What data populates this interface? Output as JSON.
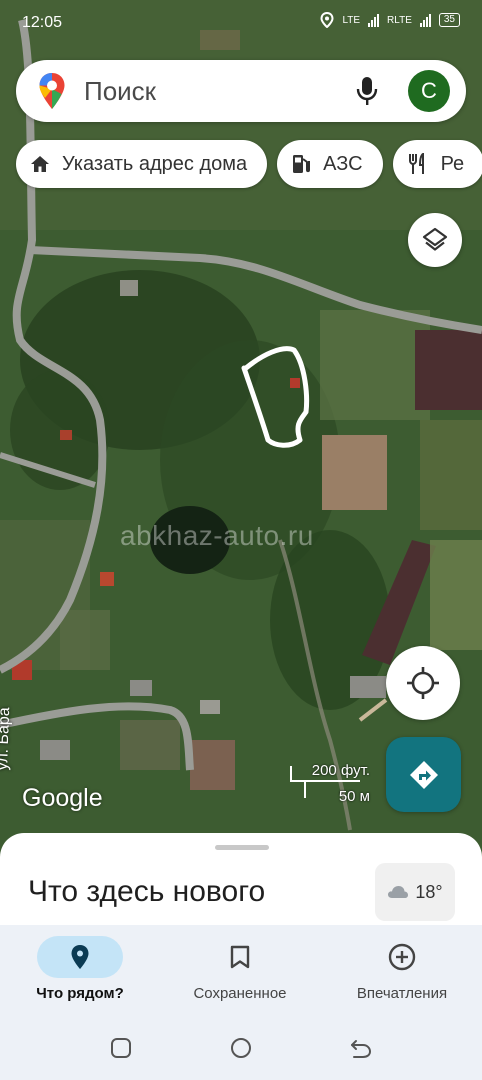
{
  "status_bar": {
    "time": "12:05",
    "lte1": "LTE",
    "lte2": "RLTE",
    "battery": "35"
  },
  "search": {
    "placeholder": "Поиск",
    "avatar_letter": "С"
  },
  "chips": [
    {
      "icon": "home-icon",
      "label": "Указать адрес дома"
    },
    {
      "icon": "gas-station-icon",
      "label": "АЗС"
    },
    {
      "icon": "restaurant-icon",
      "label": "Ре"
    }
  ],
  "map": {
    "watermark": "abkhaz-auto.ru",
    "logo": "Google",
    "street_label": "ул. Бара",
    "scale_imperial": "200 фут.",
    "scale_metric": "50 м"
  },
  "sheet": {
    "title": "Что здесь нового",
    "weather_temp": "18°",
    "weather_icon": "cloud-icon"
  },
  "bottom_nav": [
    {
      "label": "Что рядом?",
      "icon": "location-pin-icon",
      "active": true
    },
    {
      "label": "Сохраненное",
      "icon": "bookmark-icon",
      "active": false
    },
    {
      "label": "Впечатления",
      "icon": "add-circle-icon",
      "active": false
    }
  ],
  "colors": {
    "accent": "#12747f",
    "avatar": "#1f6b20",
    "nav_active_pill": "#c4e4f7"
  }
}
